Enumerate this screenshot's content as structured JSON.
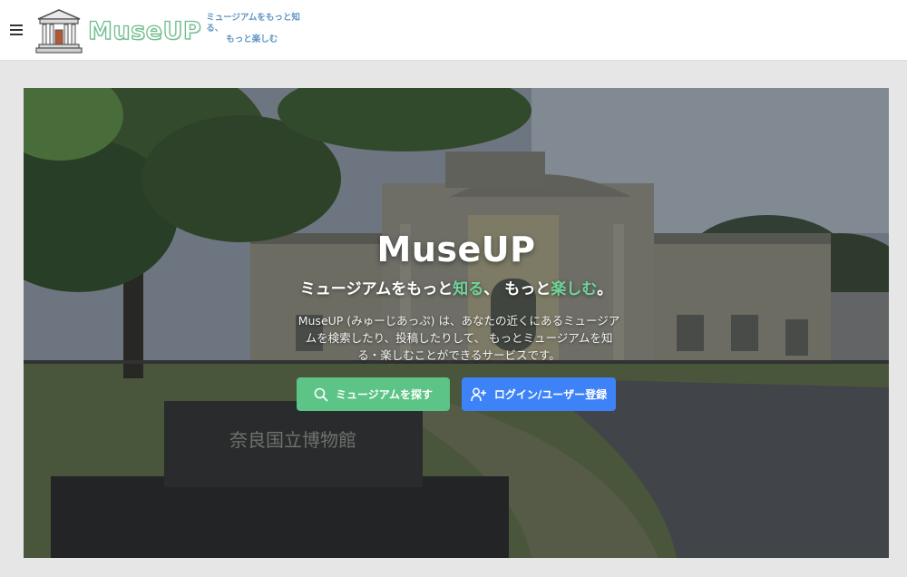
{
  "header": {
    "logo_text": "MuseUP",
    "tagline_line1": "ミュージアムをもっと知る、",
    "tagline_line2": "もっと楽しむ",
    "menu_icon": "hamburger-menu-icon"
  },
  "hero": {
    "title": "MuseUP",
    "subtitle_part1": "ミュージアムをもっと",
    "subtitle_accent1": "知る",
    "subtitle_part2": "、 もっと",
    "subtitle_accent2": "楽しむ",
    "subtitle_part3": "。",
    "description": "MuseUP (みゅーじあっぷ) は、あなたの近くにあるミュージアムを検索したり、投稿したりして、 もっとミュージアムを知る・楽しむことができるサービスです。",
    "monument_text": "奈良国立博物館",
    "colors": {
      "accent_green": "#6fd39a",
      "search_btn": "#5cc486",
      "login_btn": "#3e82f7"
    }
  },
  "buttons": {
    "search_label": "ミュージアムを探す",
    "search_icon": "search-icon",
    "login_label": "ログイン/ユーザー登録",
    "login_icon": "user-plus-icon"
  }
}
